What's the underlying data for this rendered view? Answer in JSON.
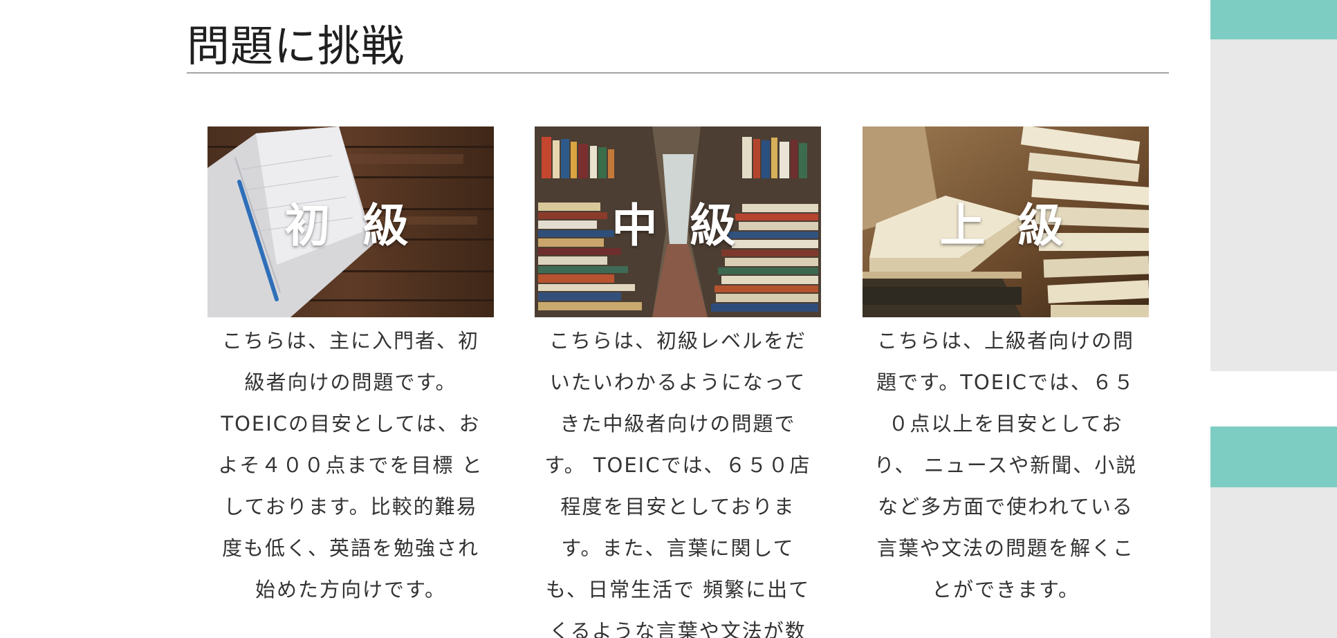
{
  "section": {
    "title": "問題に挑戦"
  },
  "cards": [
    {
      "label": "初 級",
      "description": "こちらは、主に入門者、初級者向けの問題です。TOEICの目安としては、およそ４００点までを目標 としております。比較的難易度も低く、英語を勉強され始めた方向けです。"
    },
    {
      "label": "中 級",
      "description": "こちらは、初級レベルをだいたいわかるようになってきた中級者向けの問題です。 TOEICでは、６５０店程度を目安としております。また、言葉に関しても、日常生活で 頻繁に出てくるような言葉や文法が数"
    },
    {
      "label": "上 級",
      "description": "こちらは、上級者向けの問題です。TOEICでは、６５０点以上を目安としており、 ニュースや新聞、小説など多方面で使われている言葉や文法の問題を解くことができます。"
    }
  ],
  "colors": {
    "sidebar_accent": "#7ecdc3",
    "sidebar_panel": "#e8e8e8",
    "rule": "#555555"
  }
}
